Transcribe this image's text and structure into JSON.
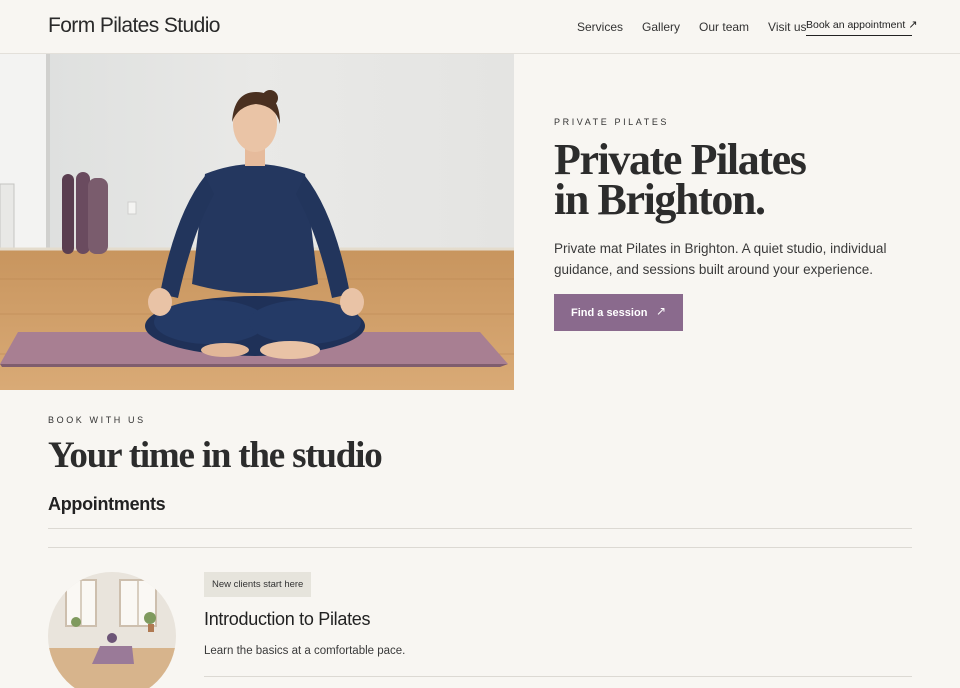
{
  "header": {
    "brand": "Form Pilates Studio",
    "nav": [
      "Services",
      "Gallery",
      "Our team",
      "Visit us"
    ],
    "book_label": "Book an appointment",
    "book_icon": "arrow-up-right-icon"
  },
  "hero": {
    "eyebrow": "PRIVATE PILATES",
    "title_line1": "Private Pilates",
    "title_line2": "in Brighton.",
    "description": "Private mat Pilates in Brighton. A quiet studio, individual guidance, and sessions built around your experience.",
    "cta_label": "Find a session",
    "cta_icon": "arrow-up-right-icon"
  },
  "booking": {
    "eyebrow": "BOOK WITH US",
    "title": "Your time in the studio",
    "appointments_heading": "Appointments"
  },
  "appointment": {
    "badge": "New clients start here",
    "title": "Introduction to Pilates",
    "description": "Learn the basics at a comfortable pace."
  },
  "colors": {
    "background": "#f8f6f2",
    "accent": "#8a6a8d",
    "badge_bg": "#e6e4dc",
    "text": "#2b2b2b"
  }
}
